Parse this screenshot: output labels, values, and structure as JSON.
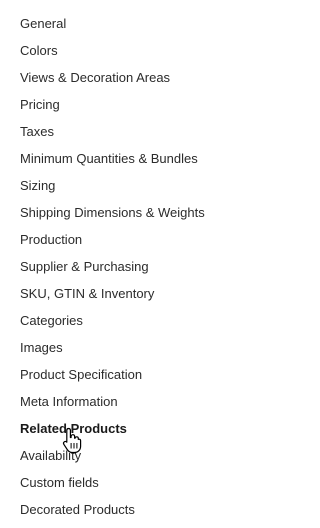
{
  "nav": {
    "items": [
      {
        "label": "General"
      },
      {
        "label": "Colors"
      },
      {
        "label": "Views & Decoration Areas"
      },
      {
        "label": "Pricing"
      },
      {
        "label": "Taxes"
      },
      {
        "label": "Minimum Quantities & Bundles"
      },
      {
        "label": "Sizing"
      },
      {
        "label": "Shipping Dimensions & Weights"
      },
      {
        "label": "Production"
      },
      {
        "label": "Supplier & Purchasing"
      },
      {
        "label": "SKU, GTIN & Inventory"
      },
      {
        "label": "Categories"
      },
      {
        "label": "Images"
      },
      {
        "label": "Product Specification"
      },
      {
        "label": "Meta Information"
      },
      {
        "label": "Related Products"
      },
      {
        "label": "Availability"
      },
      {
        "label": "Custom fields"
      },
      {
        "label": "Decorated Products"
      }
    ],
    "active_item": "Related Products"
  },
  "cursor_icon": "hand-pointer-icon"
}
